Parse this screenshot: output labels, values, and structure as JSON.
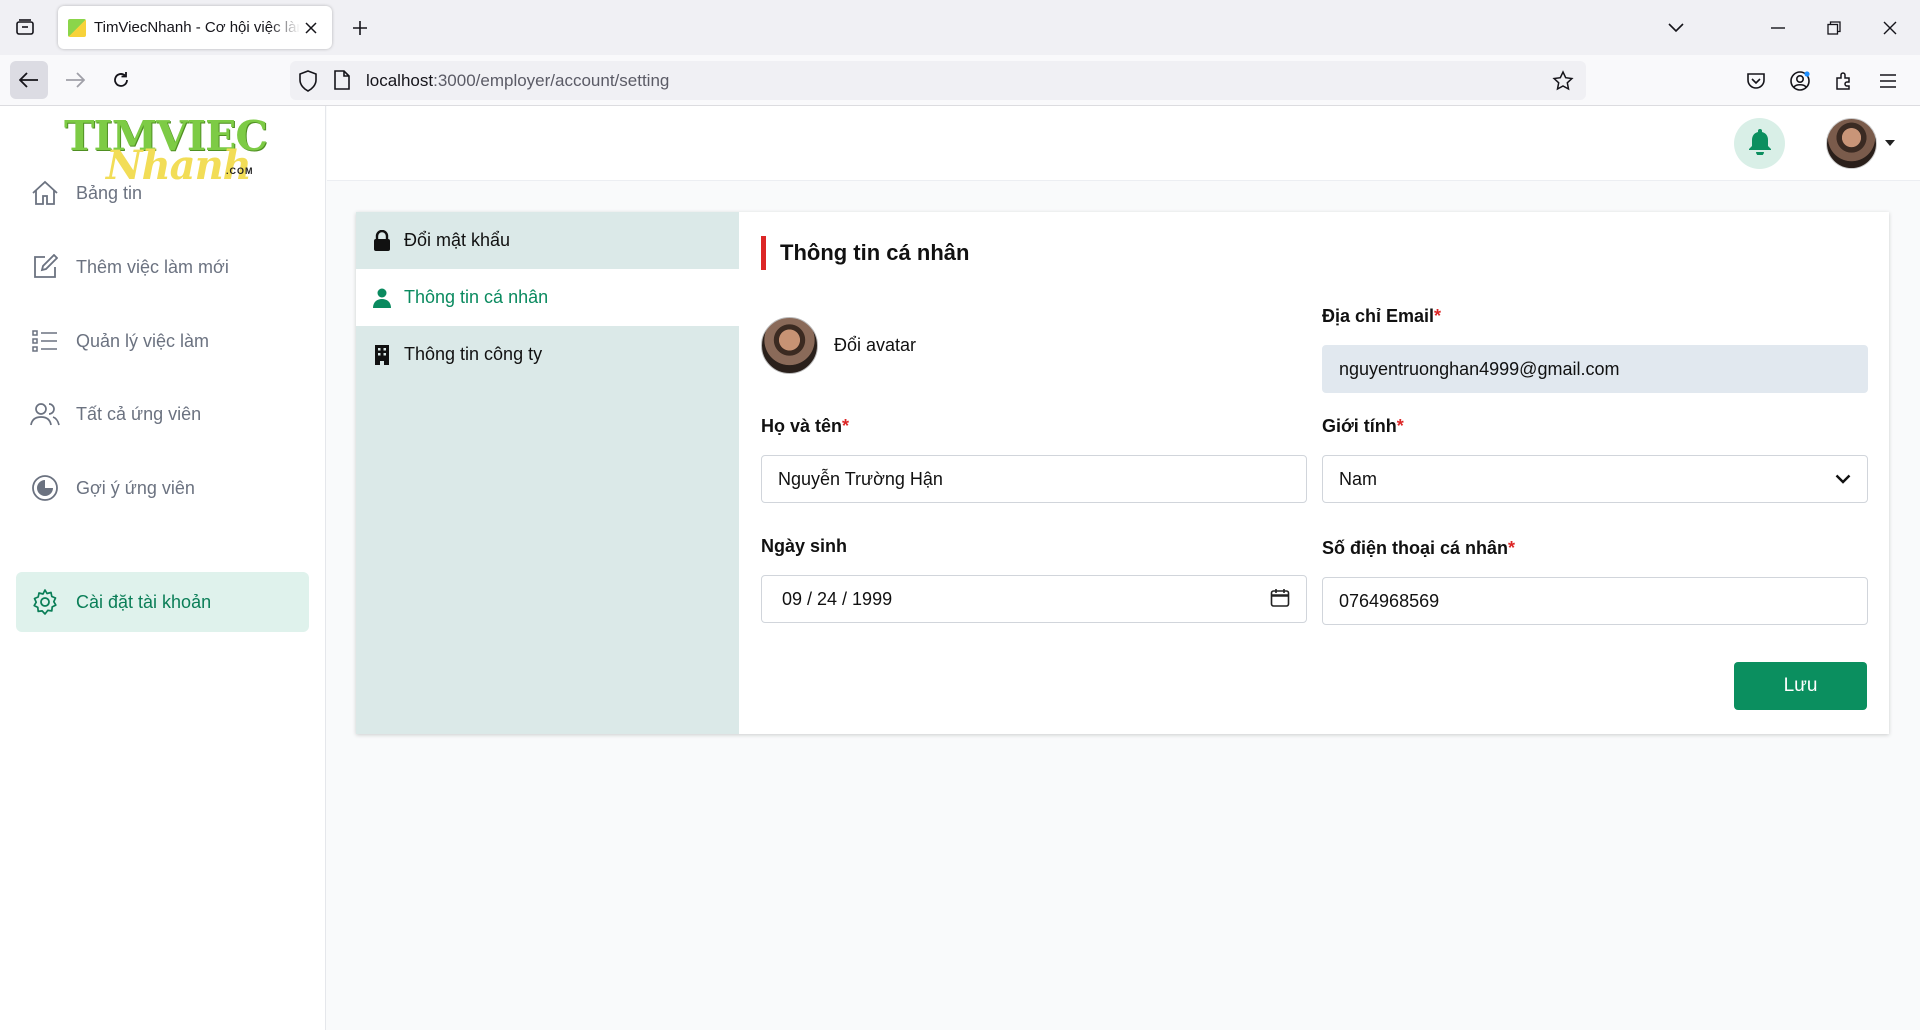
{
  "browser": {
    "tab_title": "TimViecNhanh - Cơ hội việc làm",
    "url_host": "localhost",
    "url_path": ":3000/employer/account/setting"
  },
  "logo": {
    "line1": "TIMVIEC",
    "line2": "Nhanh",
    "suffix": ".COM"
  },
  "sidebar": {
    "items": [
      {
        "label": "Bảng tin",
        "icon": "home-icon"
      },
      {
        "label": "Thêm việc làm mới",
        "icon": "edit-icon"
      },
      {
        "label": "Quản lý việc làm",
        "icon": "list-icon"
      },
      {
        "label": "Tất cả ứng viên",
        "icon": "users-icon"
      },
      {
        "label": "Gợi ý ứng viên",
        "icon": "suggest-icon"
      },
      {
        "label": "Cài đặt tài khoản",
        "icon": "gear-icon",
        "active": true
      }
    ]
  },
  "settings_nav": {
    "items": [
      {
        "label": "Đổi mật khẩu",
        "icon": "lock-icon"
      },
      {
        "label": "Thông tin cá nhân",
        "icon": "user-icon",
        "active": true
      },
      {
        "label": "Thông tin công ty",
        "icon": "building-icon"
      }
    ]
  },
  "form": {
    "title": "Thông tin cá nhân",
    "change_avatar": "Đổi avatar",
    "email_label": "Địa chỉ Email",
    "email_value": "nguyentruonghan4999@gmail.com",
    "name_label": "Họ và tên",
    "name_value": "Nguyễn Trường Hận",
    "gender_label": "Giới tính",
    "gender_value": "Nam",
    "dob_label": "Ngày sinh",
    "dob_value": "09 / 24 / 1999",
    "phone_label": "Số điện thoại cá nhân",
    "phone_value": "0764968569",
    "required_mark": "*",
    "save_label": "Lưu"
  },
  "colors": {
    "accent": "#0b8f5f",
    "active_bg": "#dff2ec",
    "settings_nav_bg": "#dbe9e8",
    "required": "#dc2626"
  }
}
